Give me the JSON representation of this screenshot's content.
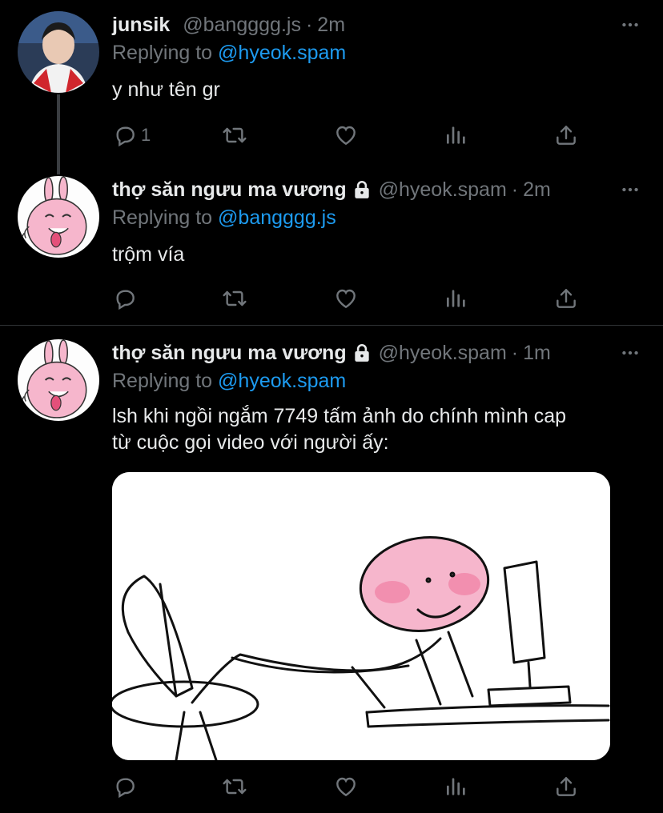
{
  "tweets": [
    {
      "name": "junsik",
      "handle": "@bangggg.js",
      "dot": "·",
      "time": "2m",
      "replying_prefix": "Replying to",
      "replying_to": "@hyeok.spam",
      "text": "y như tên gr",
      "reply_count": "1",
      "locked": false,
      "avatar": "user-photo"
    },
    {
      "name": "thợ săn ngưu ma vương",
      "handle": "@hyeok.spam",
      "dot": "·",
      "time": "2m",
      "replying_prefix": "Replying to",
      "replying_to": "@bangggg.js",
      "text": "trộm vía",
      "reply_count": "",
      "locked": true,
      "avatar": "pink-character"
    },
    {
      "name": "thợ săn ngưu ma vương",
      "handle": "@hyeok.spam",
      "dot": "·",
      "time": "1m",
      "replying_prefix": "Replying to",
      "replying_to": "@hyeok.spam",
      "text_line1": "lsh khi ngồi ngắm 7749 tấm ảnh do chính mình cap",
      "text_line2": "từ cuộc gọi video với người ấy:",
      "reply_count": "",
      "locked": true,
      "avatar": "pink-character",
      "media": "pink-blob-at-computer-drawing"
    }
  ],
  "icons": {
    "reply": "reply-icon",
    "retweet": "retweet-icon",
    "like": "heart-icon",
    "analytics": "analytics-icon",
    "share": "share-icon",
    "more": "more-icon",
    "lock": "lock-icon"
  },
  "colors": {
    "background": "#000000",
    "text": "#e7e9ea",
    "muted": "#71767b",
    "link": "#1d9bf0",
    "pink": "#f6b6cc"
  }
}
